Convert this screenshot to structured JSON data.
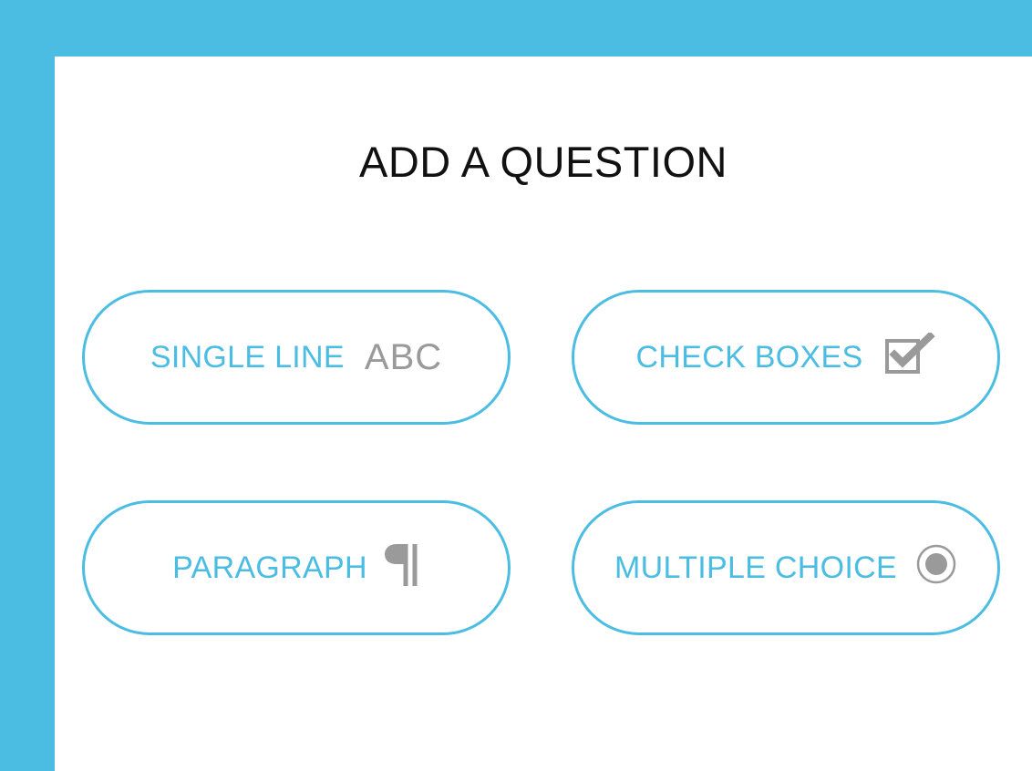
{
  "page": {
    "title": "ADD A QUESTION"
  },
  "options": [
    {
      "label": "SINGLE LINE",
      "icon": "abc-icon",
      "icon_text": "ABC"
    },
    {
      "label": "CHECK BOXES",
      "icon": "checkbox-checked-icon"
    },
    {
      "label": "PARAGRAPH",
      "icon": "paragraph-icon"
    },
    {
      "label": "MULTIPLE CHOICE",
      "icon": "radio-selected-icon"
    }
  ],
  "colors": {
    "accent": "#4bbde2",
    "icon": "#9a9a9a",
    "title": "#111111",
    "background": "#ffffff"
  }
}
